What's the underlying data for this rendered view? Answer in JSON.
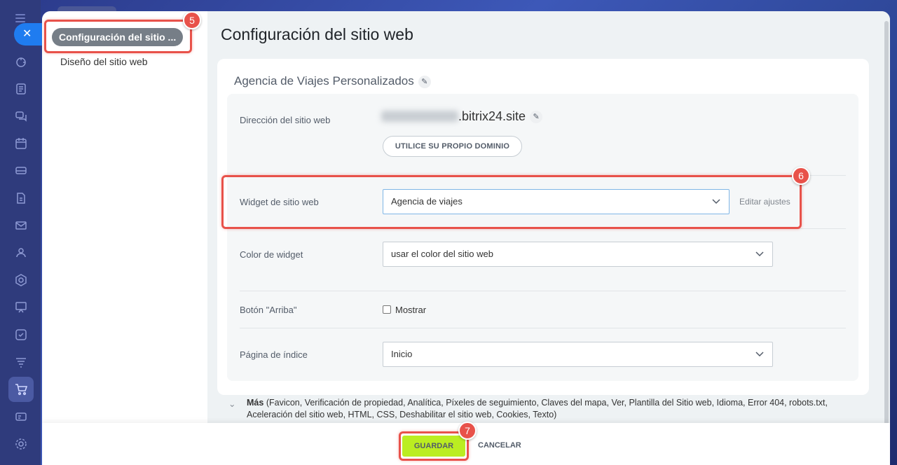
{
  "sidebar": {
    "active_item": "Configuración del sitio ...",
    "items": [
      "Diseño del sitio web"
    ]
  },
  "rail": {
    "icons": [
      "menu-icon",
      "close-icon",
      "activity-icon",
      "feed-icon",
      "chat-icon",
      "calendar-icon",
      "drive-icon",
      "document-icon",
      "mail-icon",
      "contacts-icon",
      "crm-icon",
      "presentation-icon",
      "tasks-icon",
      "filter-icon",
      "shop-icon",
      "id-card-icon",
      "settings-icon"
    ]
  },
  "header": {
    "title": "Configuración del sitio web"
  },
  "site": {
    "name": "Agencia de Viajes Personalizados",
    "address_label": "Dirección del sitio web",
    "address_domain": ".bitrix24.site",
    "own_domain_button": "UTILICE SU PROPIO DOMINIO",
    "widget_label": "Widget de sitio web",
    "widget_value": "Agencia de viajes",
    "widget_edit_link": "Editar ajustes",
    "color_label": "Color de widget",
    "color_value": "usar el color del sitio web",
    "top_button_label": "Botón \"Arriba\"",
    "top_button_option": "Mostrar",
    "index_label": "Página de índice",
    "index_value": "Inicio"
  },
  "more": {
    "label": "Más",
    "items": "(Favicon,  Verificación de propiedad,  Analítica,  Píxeles de seguimiento,  Claves del mapa,  Ver,  Plantilla del Sitio web,  Idioma,  Error 404,  robots.txt,  Aceleración del sitio web,  HTML,  CSS,  Deshabilitar el sitio web,  Cookies,  Texto)"
  },
  "footer": {
    "save_label": "GUARDAR",
    "cancel_label": "CANCELAR"
  },
  "badges": {
    "b5": "5",
    "b6": "6",
    "b7": "7"
  },
  "colors": {
    "accent": "#bbed21",
    "highlight": "#e8524a",
    "primary": "#1f7cf0"
  }
}
